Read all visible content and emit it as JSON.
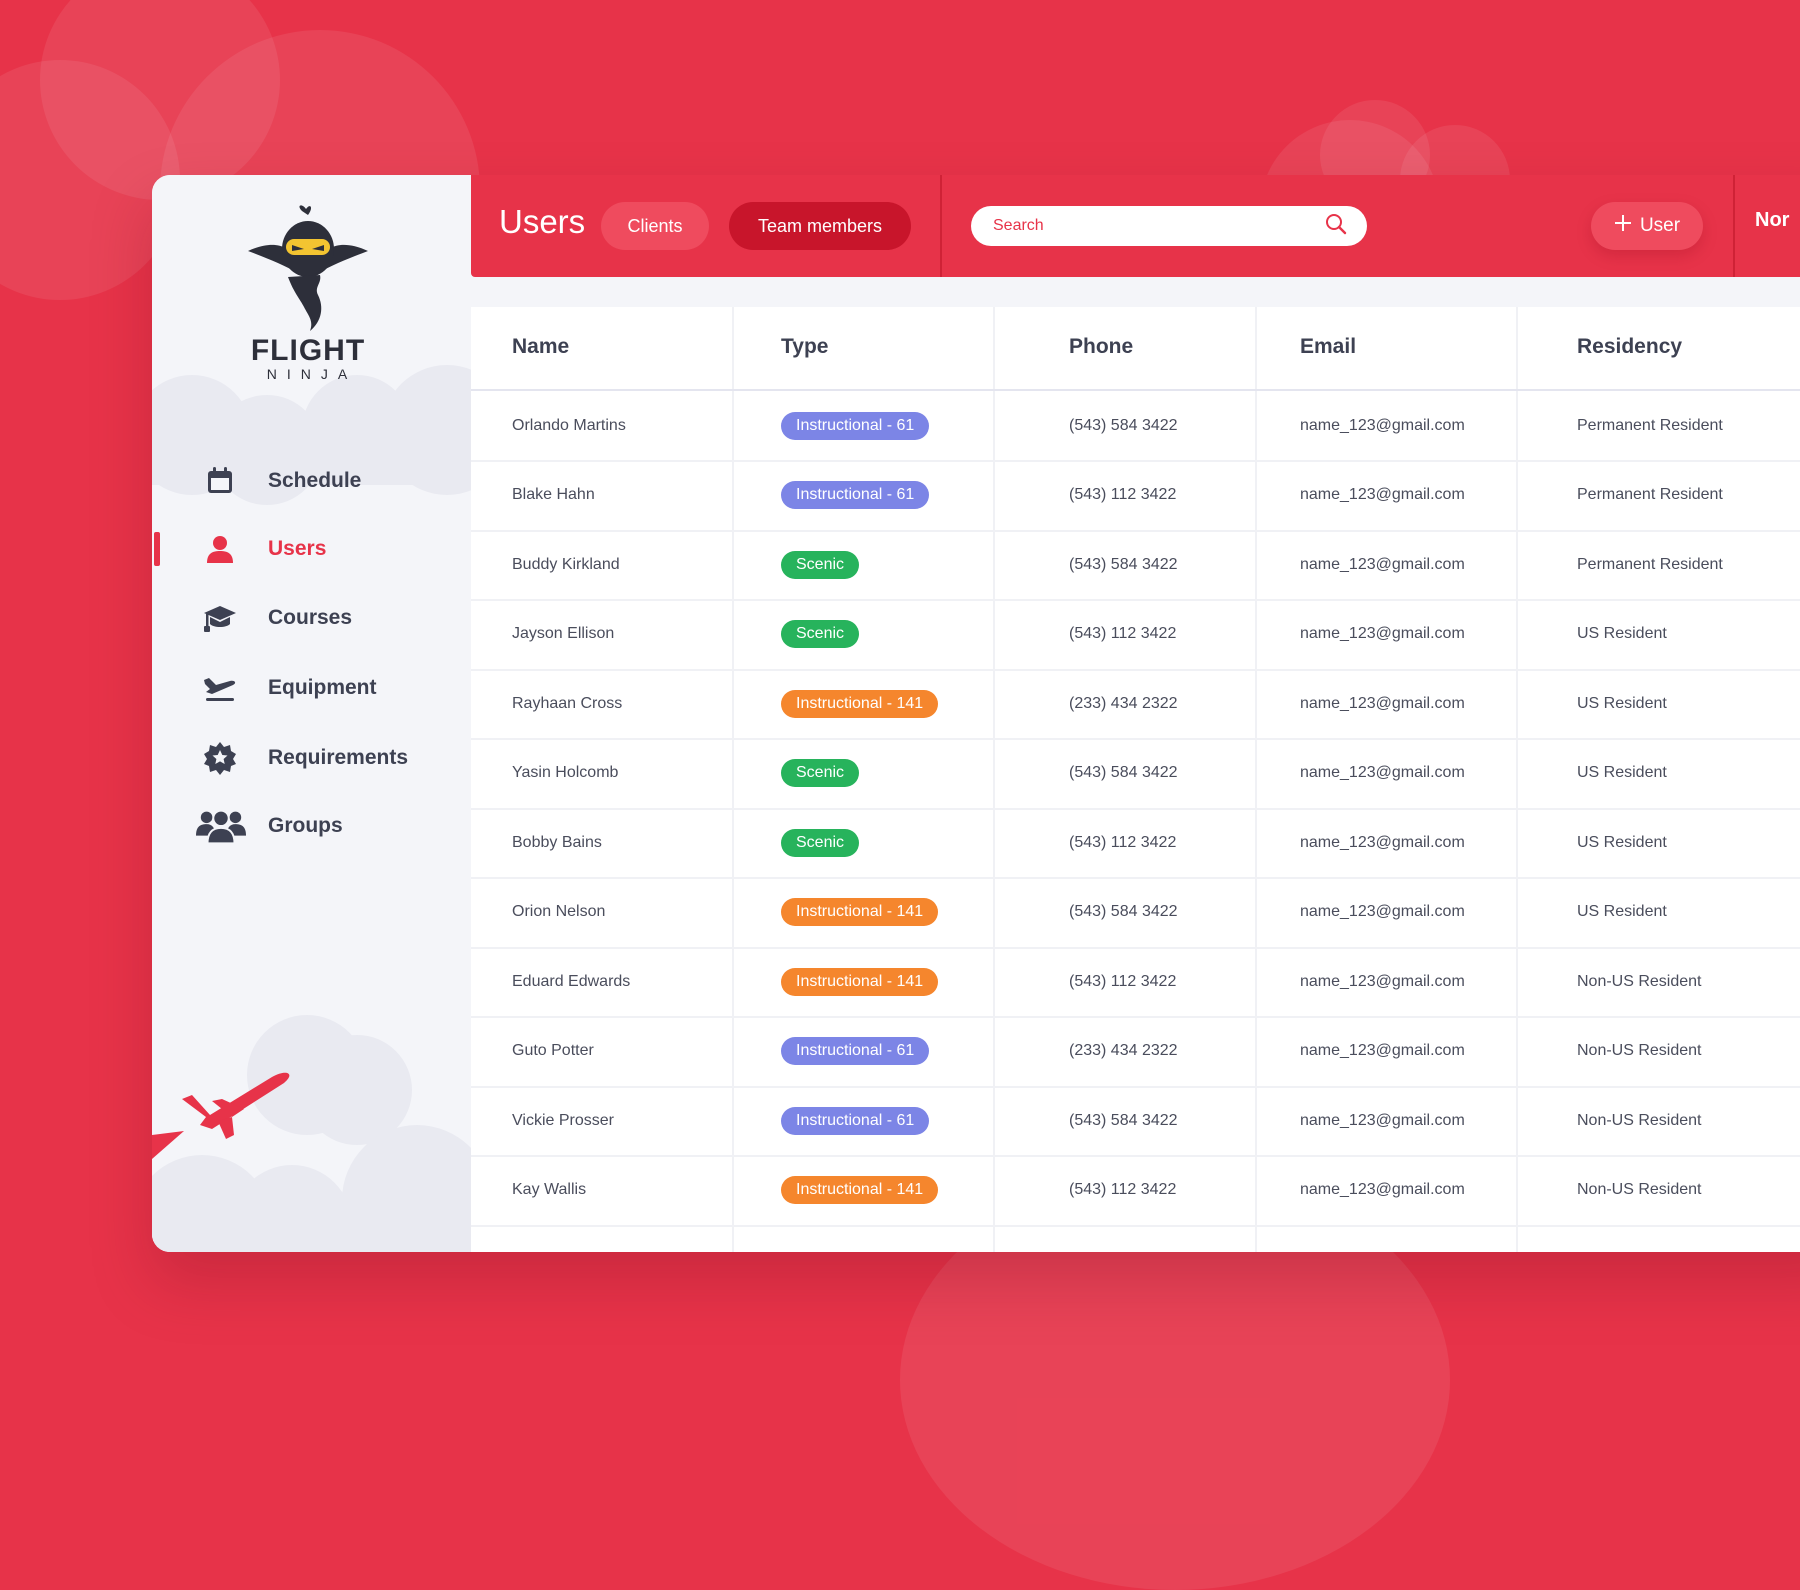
{
  "app": {
    "logo_word": "FLIGHT",
    "logo_sub": "NINJA"
  },
  "colors": {
    "accent": "#e73349",
    "instructional_61": "#7c85e6",
    "scenic": "#27b35c",
    "instructional_141": "#f5862d"
  },
  "sidebar": {
    "items": [
      {
        "label": "Schedule",
        "icon": "calendar-icon"
      },
      {
        "label": "Users",
        "icon": "user-icon",
        "active": true
      },
      {
        "label": "Courses",
        "icon": "graduation-cap-icon"
      },
      {
        "label": "Equipment",
        "icon": "airplane-icon"
      },
      {
        "label": "Requirements",
        "icon": "badge-star-icon"
      },
      {
        "label": "Groups",
        "icon": "group-icon"
      }
    ]
  },
  "header": {
    "title": "Users",
    "tabs": [
      "Clients",
      "Team members"
    ],
    "search_placeholder": "Search",
    "add_button": "User",
    "cut_text": "Nor"
  },
  "table": {
    "columns": [
      "Name",
      "Type",
      "Phone",
      "Email",
      "Residency"
    ],
    "rows": [
      {
        "name": "Orlando Martins",
        "type": "Instructional - 61",
        "type_color": "#7c85e6",
        "phone": "(543) 584 3422",
        "email": "name_123@gmail.com",
        "residency": "Permanent Resident"
      },
      {
        "name": "Blake Hahn",
        "type": "Instructional - 61",
        "type_color": "#7c85e6",
        "phone": "(543) 112 3422",
        "email": "name_123@gmail.com",
        "residency": "Permanent Resident"
      },
      {
        "name": "Buddy Kirkland",
        "type": "Scenic",
        "type_color": "#27b35c",
        "phone": "(543) 584 3422",
        "email": "name_123@gmail.com",
        "residency": "Permanent Resident"
      },
      {
        "name": "Jayson Ellison",
        "type": "Scenic",
        "type_color": "#27b35c",
        "phone": "(543) 112 3422",
        "email": "name_123@gmail.com",
        "residency": "US Resident"
      },
      {
        "name": "Rayhaan Cross",
        "type": "Instructional - 141",
        "type_color": "#f5862d",
        "phone": "(233) 434 2322",
        "email": "name_123@gmail.com",
        "residency": "US Resident"
      },
      {
        "name": "Yasin Holcomb",
        "type": "Scenic",
        "type_color": "#27b35c",
        "phone": "(543) 584 3422",
        "email": "name_123@gmail.com",
        "residency": "US Resident"
      },
      {
        "name": "Bobby Bains",
        "type": "Scenic",
        "type_color": "#27b35c",
        "phone": "(543) 112 3422",
        "email": "name_123@gmail.com",
        "residency": "US Resident"
      },
      {
        "name": "Orion Nelson",
        "type": "Instructional - 141",
        "type_color": "#f5862d",
        "phone": "(543) 584 3422",
        "email": "name_123@gmail.com",
        "residency": "US Resident"
      },
      {
        "name": "Eduard Edwards",
        "type": "Instructional - 141",
        "type_color": "#f5862d",
        "phone": "(543) 112 3422",
        "email": "name_123@gmail.com",
        "residency": "Non-US Resident"
      },
      {
        "name": "Guto Potter",
        "type": "Instructional - 61",
        "type_color": "#7c85e6",
        "phone": "(233) 434 2322",
        "email": "name_123@gmail.com",
        "residency": "Non-US Resident"
      },
      {
        "name": "Vickie Prosser",
        "type": "Instructional - 61",
        "type_color": "#7c85e6",
        "phone": "(543) 584 3422",
        "email": "name_123@gmail.com",
        "residency": "Non-US Resident"
      },
      {
        "name": "Kay Wallis",
        "type": "Instructional - 141",
        "type_color": "#f5862d",
        "phone": "(543) 112 3422",
        "email": "name_123@gmail.com",
        "residency": "Non-US Resident"
      }
    ]
  }
}
